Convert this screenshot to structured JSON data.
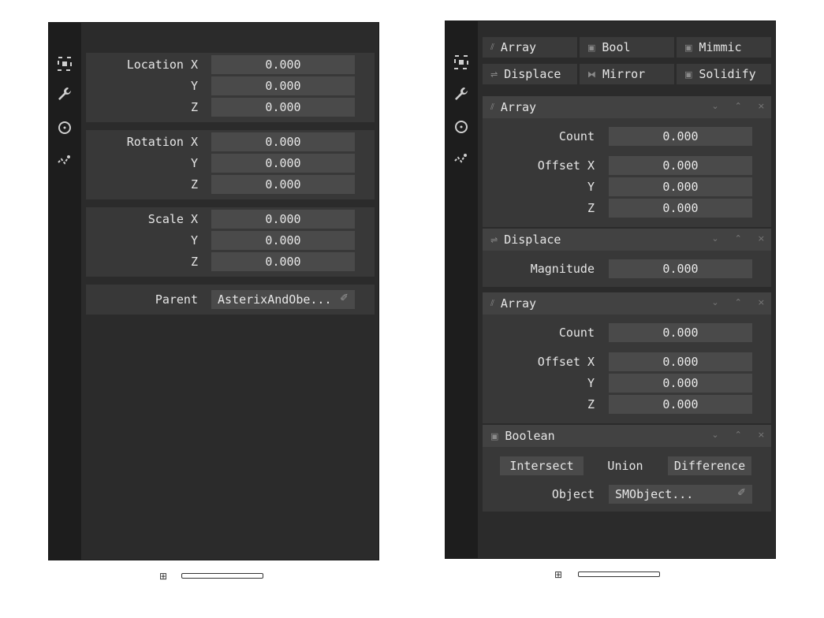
{
  "left_panel": {
    "sidebar_icons": [
      "transform-icon",
      "wrench-icon",
      "circle-icon",
      "physics-icon"
    ],
    "location": {
      "label_x": "Location X",
      "label_y": "Y",
      "label_z": "Z",
      "x": "0.000",
      "y": "0.000",
      "z": "0.000"
    },
    "rotation": {
      "label_x": "Rotation X",
      "label_y": "Y",
      "label_z": "Z",
      "x": "0.000",
      "y": "0.000",
      "z": "0.000"
    },
    "scale": {
      "label_x": "Scale X",
      "label_y": "Y",
      "label_z": "Z",
      "x": "0.000",
      "y": "0.000",
      "z": "0.000"
    },
    "parent": {
      "label": "Parent",
      "value": "AsterixAndObe...",
      "picker_icon": "eyedropper-icon"
    }
  },
  "right_panel": {
    "sidebar_icons": [
      "transform-icon",
      "wrench-icon",
      "circle-icon",
      "physics-icon"
    ],
    "add_buttons": [
      {
        "label": "Array",
        "icon": "array-icon"
      },
      {
        "label": "Bool",
        "icon": "bool-icon"
      },
      {
        "label": "Mimmic",
        "icon": "mimic-icon"
      },
      {
        "label": "Displace",
        "icon": "displace-icon"
      },
      {
        "label": "Mirror",
        "icon": "mirror-icon"
      },
      {
        "label": "Solidify",
        "icon": "solidify-icon"
      }
    ],
    "modifiers": {
      "array1": {
        "title": "Array",
        "count_label": "Count",
        "count": "0.000",
        "offset_label_x": "Offset X",
        "label_y": "Y",
        "label_z": "Z",
        "x": "0.000",
        "y": "0.000",
        "z": "0.000"
      },
      "displace": {
        "title": "Displace",
        "magnitude_label": "Magnitude",
        "magnitude": "0.000"
      },
      "array2": {
        "title": "Array",
        "count_label": "Count",
        "count": "0.000",
        "offset_label_x": "Offset X",
        "label_y": "Y",
        "label_z": "Z",
        "x": "0.000",
        "y": "0.000",
        "z": "0.000"
      },
      "boolean": {
        "title": "Boolean",
        "ops": [
          "Intersect",
          "Union",
          "Difference"
        ],
        "selected": "Union",
        "object_label": "Object",
        "object_value": "SMObject..."
      }
    },
    "header_controls": {
      "down": "⌄",
      "up": "⌃",
      "close": "×"
    }
  },
  "colors": {
    "panel_bg": "#2b2b2b",
    "sidebar_bg": "#1d1d1d",
    "field_bg": "#4a4a4a",
    "block_bg": "#383838"
  }
}
